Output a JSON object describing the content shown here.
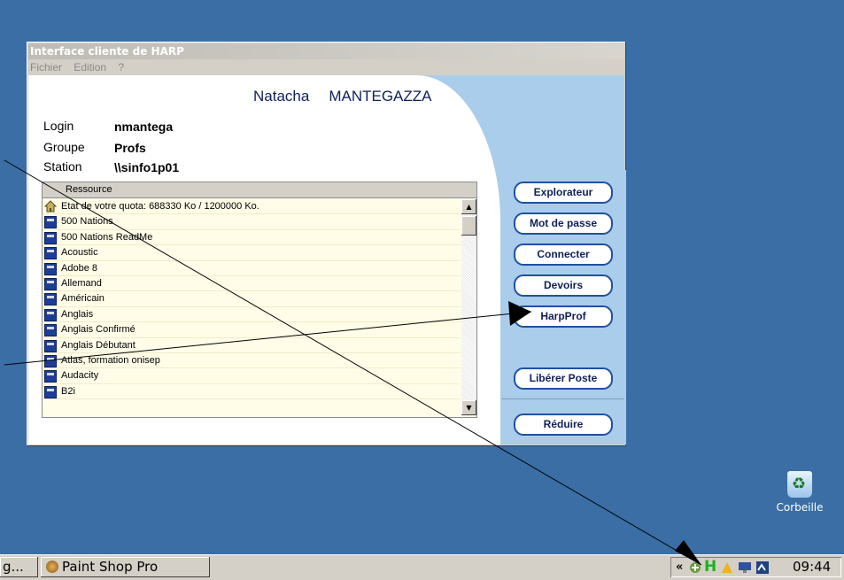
{
  "window": {
    "title": "Interface cliente de HARP",
    "menu": [
      "Fichier",
      "Edition",
      "?"
    ]
  },
  "user": {
    "first_name": "Natacha",
    "last_name": "MANTEGAZZA"
  },
  "info": {
    "login_label": "Login",
    "login_value": "nmantega",
    "group_label": "Groupe",
    "group_value": "Profs",
    "station_label": "Station",
    "station_value": "\\\\sinfo1p01"
  },
  "resources": {
    "header": "Ressource",
    "items": [
      "Etat de votre quota: 688330 Ko / 1200000 Ko.",
      "500 Nations",
      "500 Nations ReadMe",
      "Acoustic",
      "Adobe 8",
      "Allemand",
      "Américain",
      "Anglais",
      "Anglais Confirmé",
      "Anglais Débutant",
      "Atlas, formation onisep",
      "Audacity",
      "B2i"
    ]
  },
  "buttons": {
    "explorateur": "Explorateur",
    "mot_de_passe": "Mot de passe",
    "connecter": "Connecter",
    "devoirs": "Devoirs",
    "harpprof": "HarpProf",
    "liberer_poste": "Libérer Poste",
    "reduire": "Réduire"
  },
  "desktop": {
    "recycle_bin": "Corbeille"
  },
  "taskbar": {
    "task_partial": "g...",
    "task_paintshop": "Paint Shop Pro",
    "tray_chevron": "«",
    "tray_h_icon": "H",
    "clock": "09:44"
  },
  "colors": {
    "desktop": "#3a6ea5",
    "panel_blue": "#a9cdea",
    "button_border": "#2050a0",
    "name_text": "#0f2058"
  }
}
